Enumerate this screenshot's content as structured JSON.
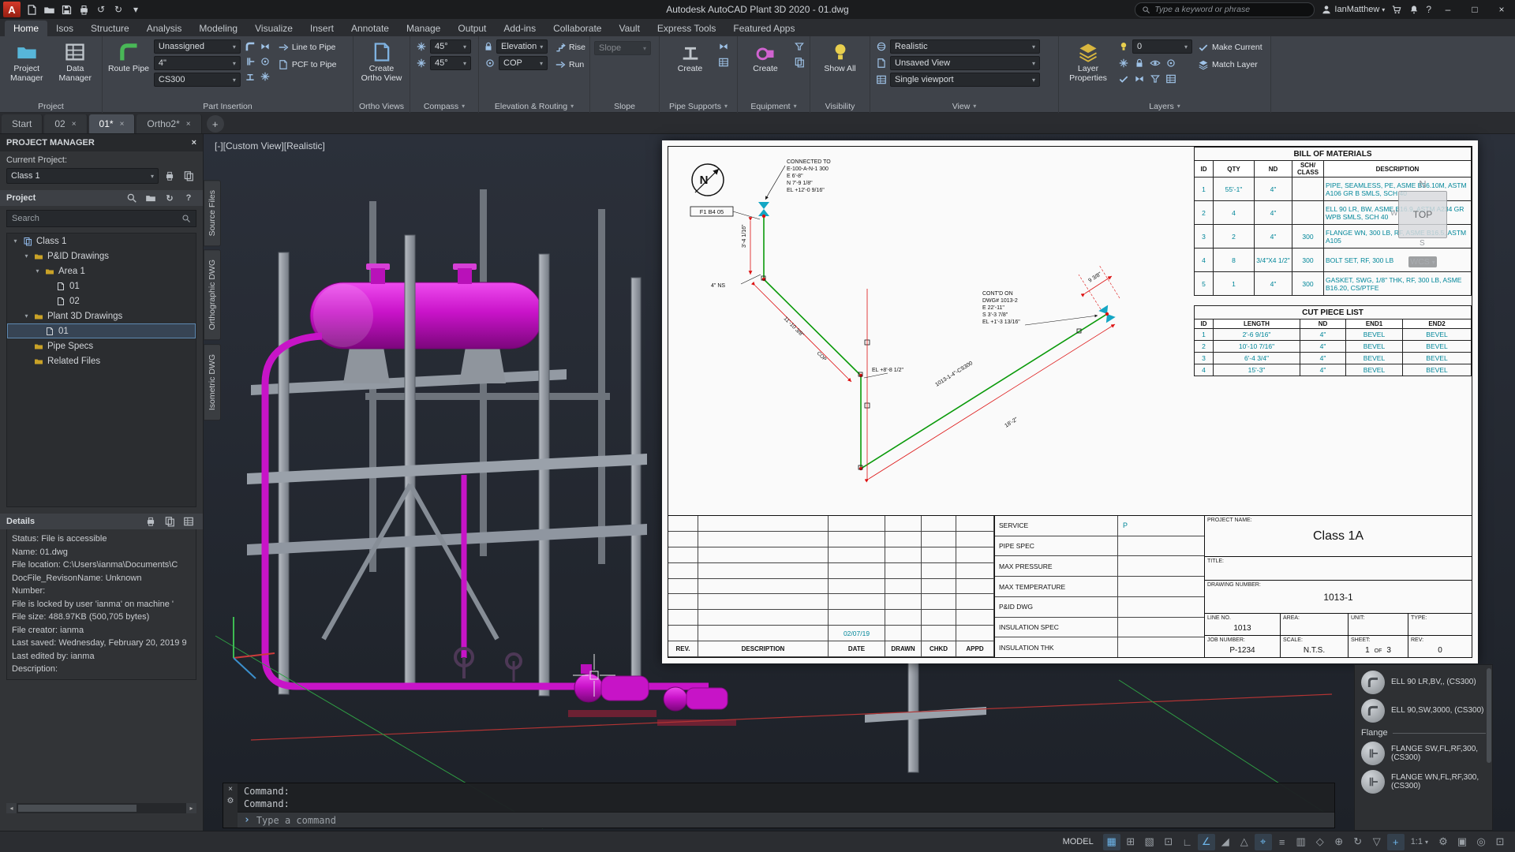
{
  "glyphs": {
    "dropdown": "▾",
    "caret_expanded": "▾",
    "close": "×",
    "minimize": "–",
    "maximize": "□",
    "undo": "↺",
    "redo": "↻",
    "question": "?",
    "prompt": "›",
    "scroll_left": "◂",
    "scroll_right": "▸",
    "plus": "+",
    "refresh": "↻",
    "gear": "⚙",
    "asterisk_new": "✲"
  },
  "title_bar": {
    "logo_letter": "A",
    "app_title": "Autodesk AutoCAD Plant 3D 2020 -   01.dwg",
    "search_placeholder": "Type a keyword or phrase",
    "user_name": "IanMatthew",
    "qat_icons": [
      "new-icon",
      "open-icon",
      "save-icon",
      "save-as-icon",
      "plot-icon",
      "undo-icon",
      "redo-icon"
    ]
  },
  "ribbon_tabs": [
    "Home",
    "Isos",
    "Structure",
    "Analysis",
    "Modeling",
    "Visualize",
    "Insert",
    "Annotate",
    "Manage",
    "Output",
    "Add-ins",
    "Collaborate",
    "Vault",
    "Express Tools",
    "Featured Apps"
  ],
  "ribbon": {
    "project": {
      "title": "Project",
      "project_manager": "Project Manager",
      "data_manager": "Data Manager"
    },
    "part_insertion": {
      "title": "Part Insertion",
      "route_pipe": "Route Pipe",
      "assignment": "Unassigned",
      "size": "4\"",
      "spec": "CS300",
      "line_to_pipe": "Line to Pipe",
      "pcf_to_pipe": "PCF to Pipe"
    },
    "ortho_views": {
      "title": "Ortho Views",
      "create_ortho_view": "Create Ortho View"
    },
    "compass": {
      "title": "Compass",
      "angle_1": "45°",
      "angle_2": "45°"
    },
    "elevation_routing": {
      "title": "Elevation & Routing",
      "elevation": "Elevation",
      "cop": "COP",
      "rise": "Rise",
      "run": "Run"
    },
    "slope": {
      "title": "Slope",
      "value": "Slope"
    },
    "pipe_supports": {
      "title": "Pipe Supports",
      "create": "Create"
    },
    "equipment": {
      "title": "Equipment",
      "create": "Create"
    },
    "visibility": {
      "title": "Visibility",
      "show_all": "Show All"
    },
    "view": {
      "title": "View",
      "visual_style": "Realistic",
      "named_view": "Unsaved View",
      "viewport_config": "Single viewport"
    },
    "layers": {
      "title": "Layers",
      "layer_properties": "Layer Properties",
      "current_layer": "0",
      "make_current": "Make Current",
      "match_layer": "Match Layer"
    }
  },
  "doc_tabs": {
    "tabs": [
      "Start",
      "02",
      "01*",
      "Ortho2*"
    ],
    "active_index": 2
  },
  "project_manager": {
    "title": "PROJECT MANAGER",
    "current_project_label": "Current Project:",
    "current_project": "Class 1",
    "section_title": "Project",
    "search_placeholder": "Search",
    "tree": [
      {
        "label": "Class 1"
      },
      {
        "label": "P&ID Drawings"
      },
      {
        "label": "Area 1"
      },
      {
        "label": "01"
      },
      {
        "label": "02"
      },
      {
        "label": "Plant 3D Drawings"
      },
      {
        "label": "01"
      },
      {
        "label": "Pipe Specs"
      },
      {
        "label": "Related Files"
      }
    ],
    "details_title": "Details",
    "details": [
      "Status: File is accessible",
      "Name: 01.dwg",
      "File location: C:\\Users\\ianma\\Documents\\C",
      "DocFile_RevisonName: Unknown",
      "Number:",
      "File is locked by user 'ianma' on machine '",
      "File size: 488.97KB (500,705 bytes)",
      "File creator: ianma",
      "Last saved: Wednesday, February 20, 2019 9",
      "Last edited by: ianma",
      "Description:"
    ]
  },
  "palette_tabs": [
    "Source Files",
    "Orthographic DWG",
    "Isometric DWG"
  ],
  "viewport": {
    "label": "[-][Custom View][Realistic]"
  },
  "viewcube": {
    "north": "N",
    "top": "TOP",
    "west": "W",
    "south": "S",
    "wcs": "WCS"
  },
  "iso_sheet": {
    "bom": {
      "title": "BILL OF MATERIALS",
      "headers": [
        "ID",
        "QTY",
        "ND",
        "SCH/ CLASS",
        "DESCRIPTION"
      ],
      "rows": [
        [
          "1",
          "55'-1\"",
          "4\"",
          "",
          "PIPE, SEAMLESS, PE, ASME B36.10M, ASTM A106 GR B SMLS, SCH 40"
        ],
        [
          "2",
          "4",
          "4\"",
          "",
          "ELL 90 LR, BW, ASME B16.9, ASTM A234 GR WPB SMLS, SCH 40"
        ],
        [
          "3",
          "2",
          "4\"",
          "300",
          "FLANGE WN, 300 LB, RF, ASME B16.5, ASTM A105"
        ],
        [
          "4",
          "8",
          "3/4\"X4 1/2\"",
          "300",
          "BOLT SET, RF, 300 LB"
        ],
        [
          "5",
          "1",
          "4\"",
          "300",
          "GASKET, SWG, 1/8\" THK, RF, 300 LB, ASME B16.20, CS/PTFE"
        ]
      ]
    },
    "cut_list": {
      "title": "CUT PIECE LIST",
      "headers": [
        "ID",
        "LENGTH",
        "ND",
        "END1",
        "END2"
      ],
      "rows": [
        [
          "1",
          "2'-6 9/16\"",
          "4\"",
          "BEVEL",
          "BEVEL"
        ],
        [
          "2",
          "10'-10 7/16\"",
          "4\"",
          "BEVEL",
          "BEVEL"
        ],
        [
          "3",
          "6'-4 3/4\"",
          "4\"",
          "BEVEL",
          "BEVEL"
        ],
        [
          "4",
          "15'-3\"",
          "4\"",
          "BEVEL",
          "BEVEL"
        ]
      ]
    },
    "sketch": {
      "north": "N",
      "connected_to": [
        "CONNECTED TO",
        "E-100-A-N-1 300",
        "E 6'-8\"",
        "N 7'-9 1/8\"",
        "EL +12'-0 9/16\""
      ],
      "contd_on": [
        "CONT'D ON",
        "DWG# 1013-2",
        "E 22'-11\"",
        "S 3'-3 7/8\"",
        "EL +1'-3 13/16\""
      ],
      "grid_tag": "F1 B4 05",
      "ns_label": "4\" NS",
      "dim_vertical": "3'-4 1/16\"",
      "dim_run1": "11'-10 3/8\"",
      "cop": "COP",
      "elevation_note": "EL +8'-8 1/2\"",
      "line_tag": "1013-1-4\"-CS300",
      "dim_run2": "18'-2\"",
      "dim_end": "9 3/8\""
    },
    "title_block": {
      "spec_rows": [
        {
          "label": "SERVICE",
          "value": "P"
        },
        {
          "label": "PIPE SPEC",
          "value": ""
        },
        {
          "label": "MAX PRESSURE",
          "value": ""
        },
        {
          "label": "MAX TEMPERATURE",
          "value": ""
        },
        {
          "label": "P&ID DWG",
          "value": ""
        },
        {
          "label": "INSULATION SPEC",
          "value": ""
        },
        {
          "label": "INSULATION THK",
          "value": ""
        }
      ],
      "project_name_label": "PROJECT NAME:",
      "project_name": "Class 1A",
      "title_label": "TITLE:",
      "drawing_number_label": "DRAWING NUMBER:",
      "drawing_number": "1013-1",
      "line_no_label": "LINE NO.",
      "line_no": "1013",
      "area_label": "AREA:",
      "unit_label": "UNIT:",
      "type_label": "TYPE:",
      "job_number_label": "JOB NUMBER:",
      "job_number": "P-1234",
      "scale_label": "SCALE:",
      "scale": "N.T.S.",
      "sheet_label": "SHEET:",
      "sheet_no": "1",
      "of_label": "OF",
      "sheet_total": "3",
      "rev_label": "REV:",
      "rev_no": "0",
      "date_value": "02/07/19",
      "footer_headers": [
        "REV.",
        "DESCRIPTION",
        "DATE",
        "DRAWN",
        "CHKD",
        "APPD"
      ]
    }
  },
  "tool_palette": {
    "items_a": [
      {
        "label": "ELL 90 LR,BV,, (CS300)"
      },
      {
        "label": "ELL 90,SW,3000, (CS300)"
      }
    ],
    "group_label": "Flange",
    "items_b": [
      {
        "label": "FLANGE SW,FL,RF,300, (CS300)"
      },
      {
        "label": "FLANGE WN,FL,RF,300, (CS300)"
      }
    ]
  },
  "command_line": {
    "history": [
      "Command:",
      "Command:"
    ],
    "prompt": "Type a command"
  },
  "status_bar": {
    "model_label": "MODEL",
    "annotation_scale": "1:1",
    "icons": [
      {
        "name": "grid-display",
        "glyph": "▦"
      },
      {
        "name": "snap-mode",
        "glyph": "⊞"
      },
      {
        "name": "infer-constraints",
        "glyph": "▧"
      },
      {
        "name": "dynamic-input",
        "glyph": "⊡"
      },
      {
        "name": "ortho-mode",
        "glyph": "∟"
      },
      {
        "name": "polar-tracking",
        "glyph": "∠"
      },
      {
        "name": "isometric-drafting",
        "glyph": "◢"
      },
      {
        "name": "object-snap-tracking",
        "glyph": "△"
      },
      {
        "name": "object-snap-2d",
        "glyph": "⌖"
      },
      {
        "name": "lineweight",
        "glyph": "≡"
      },
      {
        "name": "transparency",
        "glyph": "▥"
      },
      {
        "name": "selection-cycling",
        "glyph": "◇"
      },
      {
        "name": "object-snap-3d",
        "glyph": "⊕"
      },
      {
        "name": "dynamic-ucs",
        "glyph": "↻"
      },
      {
        "name": "selection-filtering",
        "glyph": "▽"
      },
      {
        "name": "gizmo",
        "glyph": "+"
      }
    ],
    "tail_icons": [
      {
        "name": "workspace-switching",
        "glyph": "⚙"
      },
      {
        "name": "annotation-monitor",
        "glyph": "▣"
      },
      {
        "name": "isolate-objects",
        "glyph": "◎"
      },
      {
        "name": "clean-screen",
        "glyph": "⊡"
      }
    ]
  }
}
